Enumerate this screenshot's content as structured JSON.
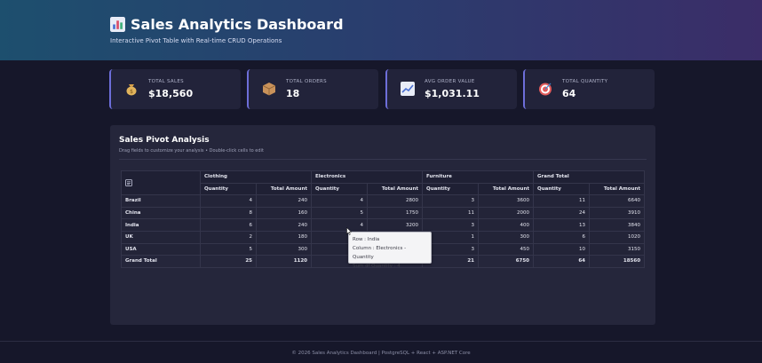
{
  "header": {
    "title": "Sales Analytics Dashboard",
    "subtitle": "Interactive Pivot Table with Real-time CRUD Operations",
    "icon": "bar-chart-icon"
  },
  "cards": [
    {
      "label": "TOTAL SALES",
      "value": "$18,560",
      "icon": "money-bag-icon",
      "color": "#f1c15b"
    },
    {
      "label": "TOTAL ORDERS",
      "value": "18",
      "icon": "package-icon",
      "color": "#c9925a"
    },
    {
      "label": "AVG ORDER VALUE",
      "value": "$1,031.11",
      "icon": "trend-chart-icon",
      "color": "#5b8fd8"
    },
    {
      "label": "TOTAL QUANTITY",
      "value": "64",
      "icon": "target-icon",
      "color": "#e25b5b"
    }
  ],
  "pivot": {
    "title": "Sales Pivot Analysis",
    "hint": "Drag fields to customize your analysis • Double-click cells to edit",
    "column_groups": [
      "Clothing",
      "Electronics",
      "Furniture",
      "Grand Total"
    ],
    "measures": [
      "Quantity",
      "Total Amount"
    ],
    "rows": [
      {
        "label": "Brazil",
        "values": [
          "4",
          "240",
          "4",
          "2800",
          "3",
          "3600",
          "11",
          "6640"
        ]
      },
      {
        "label": "China",
        "values": [
          "8",
          "160",
          "5",
          "1750",
          "11",
          "2000",
          "24",
          "3910"
        ]
      },
      {
        "label": "India",
        "values": [
          "6",
          "240",
          "4",
          "3200",
          "3",
          "400",
          "13",
          "3840"
        ]
      },
      {
        "label": "UK",
        "values": [
          "2",
          "180",
          "",
          "",
          "1",
          "300",
          "6",
          "1020"
        ]
      },
      {
        "label": "USA",
        "values": [
          "5",
          "300",
          "",
          "",
          "3",
          "450",
          "10",
          "3150"
        ]
      }
    ],
    "grand_total": {
      "label": "Grand Total",
      "values": [
        "25",
        "1120",
        "",
        "",
        "21",
        "6750",
        "64",
        "18560"
      ]
    }
  },
  "tooltip": {
    "row": "Row : India",
    "column": "Column : Electronics - Quantity",
    "sum": "Sum of Quantity : 4"
  },
  "footer": {
    "text": "© 2026 Sales Analytics Dashboard | PostgreSQL + React + ASP.NET Core"
  },
  "colors": {
    "accent": "#6d6ed9",
    "background": "#16172a",
    "header_gradient_start": "#1d4f6e",
    "header_gradient_end": "#3b2d68"
  }
}
